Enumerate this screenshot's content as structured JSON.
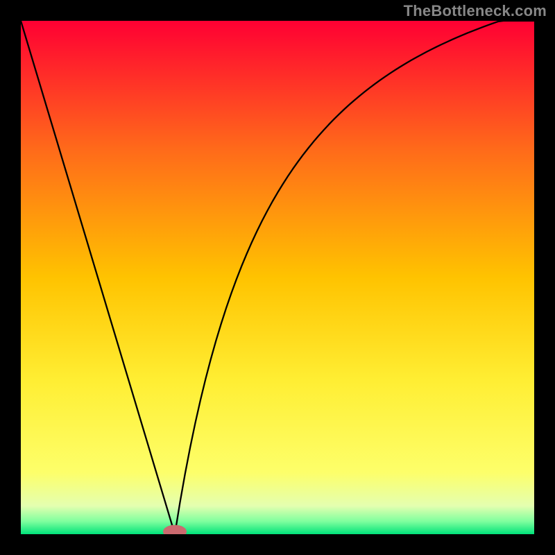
{
  "watermark": "TheBottleneck.com",
  "chart_data": {
    "type": "line",
    "title": "",
    "subtitle": "",
    "xlabel": "",
    "ylabel": "",
    "xlim": [
      0,
      100
    ],
    "ylim": [
      0,
      100
    ],
    "grid": false,
    "gradient_stops": [
      {
        "offset": 0.0,
        "color": "#ff0033"
      },
      {
        "offset": 0.25,
        "color": "#ff6a1a"
      },
      {
        "offset": 0.5,
        "color": "#ffc300"
      },
      {
        "offset": 0.7,
        "color": "#ffee33"
      },
      {
        "offset": 0.88,
        "color": "#fdff6a"
      },
      {
        "offset": 0.945,
        "color": "#e4ffb0"
      },
      {
        "offset": 0.975,
        "color": "#7fff9e"
      },
      {
        "offset": 1.0,
        "color": "#00e37a"
      }
    ],
    "series": [
      {
        "name": "curve",
        "color": "#000000",
        "width": 2.3,
        "x": [
          0,
          1,
          2,
          3,
          4,
          5,
          6,
          7,
          8,
          9,
          10,
          11,
          12,
          13,
          14,
          15,
          16,
          17,
          18,
          19,
          20,
          21,
          22,
          23,
          24,
          25,
          26,
          27,
          28,
          29,
          30,
          31,
          32,
          33,
          34,
          35,
          36,
          37,
          38,
          39,
          40,
          41,
          42,
          43,
          44,
          45,
          46,
          47,
          48,
          49,
          50,
          51,
          52,
          53,
          54,
          55,
          56,
          57,
          58,
          59,
          60,
          61,
          62,
          63,
          64,
          65,
          66,
          67,
          68,
          69,
          70,
          71,
          72,
          73,
          74,
          75,
          76,
          77,
          78,
          79,
          80,
          81,
          82,
          83,
          84,
          85,
          86,
          87,
          88,
          89,
          90,
          91,
          92,
          93,
          94,
          95,
          96,
          97,
          98,
          99,
          100
        ],
        "values": [
          100,
          96.67,
          93.33,
          90,
          86.67,
          83.33,
          80,
          76.67,
          73.33,
          70,
          66.67,
          63.33,
          60,
          56.67,
          53.33,
          50,
          46.67,
          43.33,
          40,
          36.67,
          33.33,
          30,
          26.67,
          23.33,
          20,
          16.67,
          13.33,
          10,
          6.67,
          3.33,
          0,
          6.15,
          11.79,
          16.97,
          21.75,
          26.17,
          30.27,
          34.08,
          37.62,
          40.93,
          44.03,
          46.93,
          49.65,
          52.21,
          54.61,
          56.88,
          59.02,
          61.05,
          62.96,
          64.78,
          66.5,
          68.13,
          69.69,
          71.17,
          72.58,
          73.92,
          75.2,
          76.43,
          77.6,
          78.72,
          79.8,
          80.83,
          81.82,
          82.77,
          83.68,
          84.55,
          85.39,
          86.2,
          86.98,
          87.73,
          88.46,
          89.15,
          89.82,
          90.47,
          91.1,
          91.7,
          92.29,
          92.85,
          93.4,
          93.93,
          94.44,
          94.94,
          95.42,
          95.88,
          96.34,
          96.78,
          97.2,
          97.62,
          98.02,
          98.41,
          98.79,
          99.16,
          99.52,
          99.87,
          100,
          100,
          100,
          100,
          100,
          100,
          100
        ]
      }
    ],
    "marker": {
      "x": 30,
      "y": 0.5,
      "rx": 2.3,
      "ry": 1.3,
      "color": "#cb6a6f"
    }
  }
}
